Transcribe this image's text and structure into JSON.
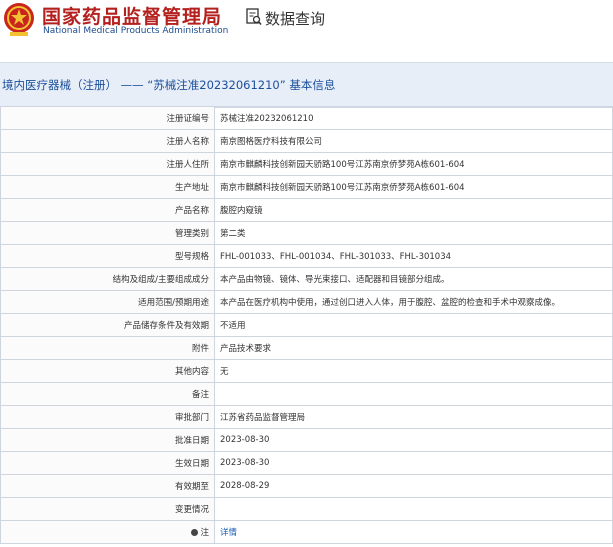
{
  "header": {
    "site_name_cn": "国家药品监督管理局",
    "site_name_en": "National Medical Products Administration",
    "page_title": "数据查询",
    "brand_color": "#b4201d"
  },
  "section": {
    "title": "境内医疗器械（注册） —— “苏械注准20232061210” 基本信息"
  },
  "rows": [
    {
      "label": "注册证编号",
      "value": "苏械注准20232061210"
    },
    {
      "label": "注册人名称",
      "value": "南京图格医疗科技有限公司"
    },
    {
      "label": "注册人住所",
      "value": "南京市麒麟科技创新园天骄路100号江苏南京侨梦苑A栋601-604"
    },
    {
      "label": "生产地址",
      "value": "南京市麒麟科技创新园天骄路100号江苏南京侨梦苑A栋601-604"
    },
    {
      "label": "产品名称",
      "value": "腹腔内窥镜"
    },
    {
      "label": "管理类别",
      "value": "第二类"
    },
    {
      "label": "型号规格",
      "value": "FHL-001033、FHL-001034、FHL-301033、FHL-301034"
    },
    {
      "label": "结构及组成/主要组成成分",
      "value": "本产品由物镜、镜体、导光束接口、适配器和目镜部分组成。"
    },
    {
      "label": "适用范围/预期用途",
      "value": "本产品在医疗机构中使用，通过创口进入人体，用于腹腔、盆腔的检查和手术中观察成像。"
    },
    {
      "label": "产品储存条件及有效期",
      "value": "不适用"
    },
    {
      "label": "附件",
      "value": "产品技术要求"
    },
    {
      "label": "其他内容",
      "value": "无"
    },
    {
      "label": "备注",
      "value": ""
    },
    {
      "label": "审批部门",
      "value": "江苏省药品监督管理局"
    },
    {
      "label": "批准日期",
      "value": "2023-08-30"
    },
    {
      "label": "生效日期",
      "value": "2023-08-30"
    },
    {
      "label": "有效期至",
      "value": "2028-08-29"
    },
    {
      "label": "变更情况",
      "value": ""
    },
    {
      "label": "注",
      "value": "详情",
      "icon": "info-icon"
    }
  ]
}
